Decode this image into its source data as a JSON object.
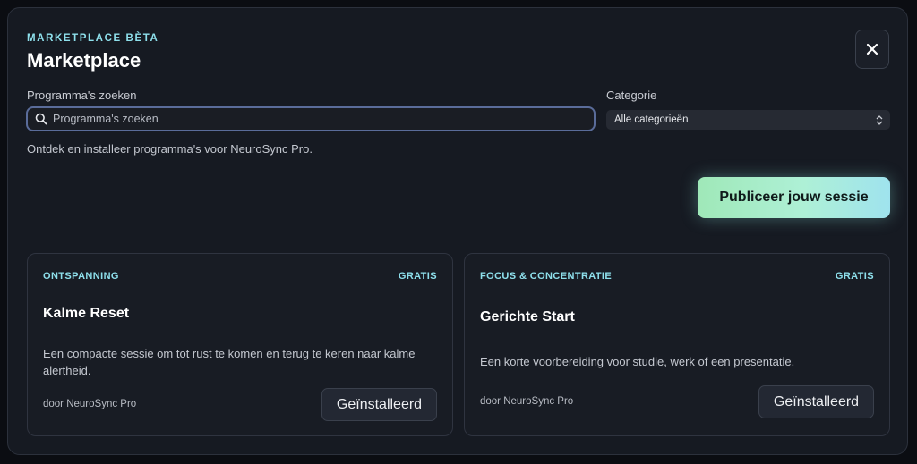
{
  "header": {
    "eyebrow": "MARKETPLACE BÈTA",
    "title": "Marketplace",
    "close_icon": "close-icon"
  },
  "search": {
    "label": "Programma's zoeken",
    "placeholder": "Programma's zoeken",
    "value": "",
    "icon": "search-icon"
  },
  "category": {
    "label": "Categorie",
    "selected": "Alle categorieën",
    "icon": "updown-chevron-icon"
  },
  "description": "Ontdek en installeer programma's voor NeuroSync Pro.",
  "publish_button": "Publiceer jouw sessie",
  "cards": [
    {
      "category": "ONTSPANNING",
      "price": "GRATIS",
      "name": "Kalme Reset",
      "body": "Een compacte sessie om tot rust te komen en terug te keren naar kalme alertheid.",
      "author": "door NeuroSync Pro",
      "button": "Geïnstalleerd"
    },
    {
      "category": "FOCUS & CONCENTRATIE",
      "price": "GRATIS",
      "name": "Gerichte Start",
      "body": "Een korte voorbereiding voor studie, werk of een presentatie.",
      "author": "door NeuroSync Pro",
      "button": "Geïnstalleerd"
    }
  ],
  "colors": {
    "accent": "#8ee0ec",
    "background": "#161a22",
    "card": "#181c24",
    "publish_gradient_start": "#9fe8b8",
    "publish_gradient_end": "#9fe3ee"
  }
}
